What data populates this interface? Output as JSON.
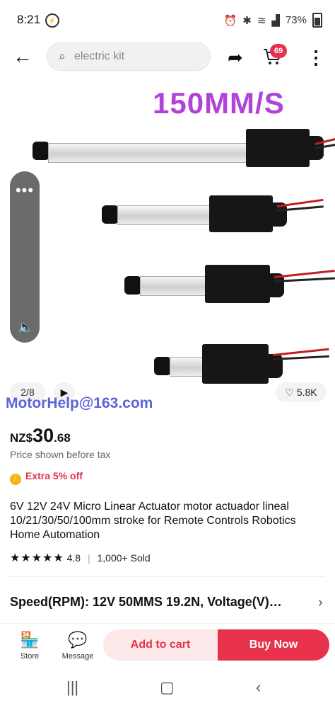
{
  "status_bar": {
    "time": "8:21",
    "icons": [
      "messenger-icon",
      "alarm-icon",
      "bluetooth-icon",
      "wifi-icon",
      "volte-icon",
      "signal-icon"
    ],
    "battery": "73%"
  },
  "top_bar": {
    "search_placeholder": "electric kit",
    "cart_count": "69"
  },
  "gallery": {
    "promo_text": "150MM/S",
    "pager": "2/8",
    "likes": "5.8K",
    "watermark": "MotorHelp@163.com",
    "image_count_current": 2,
    "image_count_total": 8
  },
  "price": {
    "currency": "NZ$",
    "integer": "30",
    "decimal": ".68",
    "note": "Price shown before tax"
  },
  "promo_badge": "Extra 5% off",
  "product_title": "6V 12V 24V Micro Linear Actuator motor actuador lineal 10/21/30/50/100mm stroke for Remote Controls Robotics Home Automation",
  "rating": {
    "stars": "★★★★★",
    "score": "4.8",
    "sold": "1,000+ Sold"
  },
  "spec": "Speed(RPM): 12V 50MMS 19.2N, Voltage(V)…",
  "bottom_bar": {
    "store_label": "Store",
    "message_label": "Message",
    "add_to_cart": "Add to cart",
    "buy_now": "Buy Now"
  },
  "colors": {
    "accent": "#e8324b",
    "promo": "#b044d9",
    "watermark": "#5b63d9",
    "add_cart_bg": "#fde8ea"
  }
}
